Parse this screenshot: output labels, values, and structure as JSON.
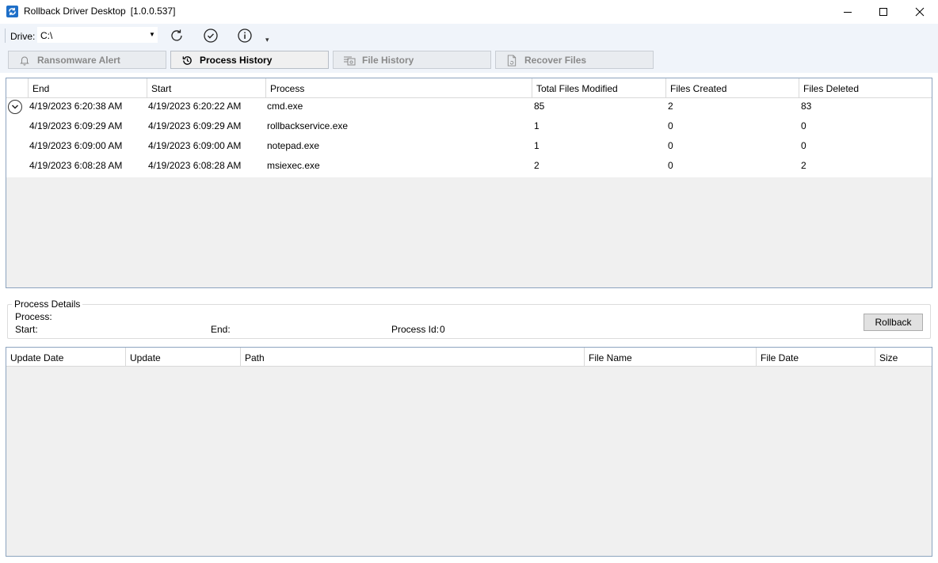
{
  "window": {
    "title": "Rollback Driver Desktop",
    "version": "[1.0.0.537]",
    "minimize_glyph": "—",
    "maximize_glyph": "☐",
    "close_glyph": "✕"
  },
  "toolbar": {
    "drive_label": "Drive:",
    "drive_value": "C:\\",
    "icons": [
      "refresh-icon",
      "check-circle-icon",
      "info-icon"
    ],
    "more_glyph": "▾"
  },
  "tabs": [
    {
      "label": "Ransomware Alert",
      "icon": "bell-icon",
      "active": false
    },
    {
      "label": "Process History",
      "icon": "history-icon",
      "active": true
    },
    {
      "label": "File History",
      "icon": "file-history-icon",
      "active": false
    },
    {
      "label": "Recover Files",
      "icon": "recover-file-icon",
      "active": false
    }
  ],
  "process_grid": {
    "columns": [
      "End",
      "Start",
      "Process",
      "Total Files Modified",
      "Files Created",
      "Files Deleted"
    ],
    "rows": [
      {
        "end": "4/19/2023 6:20:38 AM",
        "start": "4/19/2023 6:20:22 AM",
        "process": "cmd.exe",
        "total": "85",
        "created": "2",
        "deleted": "83",
        "expandable": true
      },
      {
        "end": "4/19/2023 6:09:29 AM",
        "start": "4/19/2023 6:09:29 AM",
        "process": "rollbackservice.exe",
        "total": "1",
        "created": "0",
        "deleted": "0",
        "expandable": false
      },
      {
        "end": "4/19/2023 6:09:00 AM",
        "start": "4/19/2023 6:09:00 AM",
        "process": "notepad.exe",
        "total": "1",
        "created": "0",
        "deleted": "0",
        "expandable": false
      },
      {
        "end": "4/19/2023 6:08:28 AM",
        "start": "4/19/2023 6:08:28 AM",
        "process": "msiexec.exe",
        "total": "2",
        "created": "0",
        "deleted": "2",
        "expandable": false
      }
    ]
  },
  "process_details": {
    "legend": "Process Details",
    "process_label": "Process:",
    "start_label": "Start:",
    "end_label": "End:",
    "process_id_label": "Process Id:",
    "process_id_value": "0",
    "rollback_label": "Rollback"
  },
  "file_grid": {
    "columns": [
      "Update Date",
      "Update",
      "Path",
      "File Name",
      "File Date",
      "Size"
    ]
  }
}
